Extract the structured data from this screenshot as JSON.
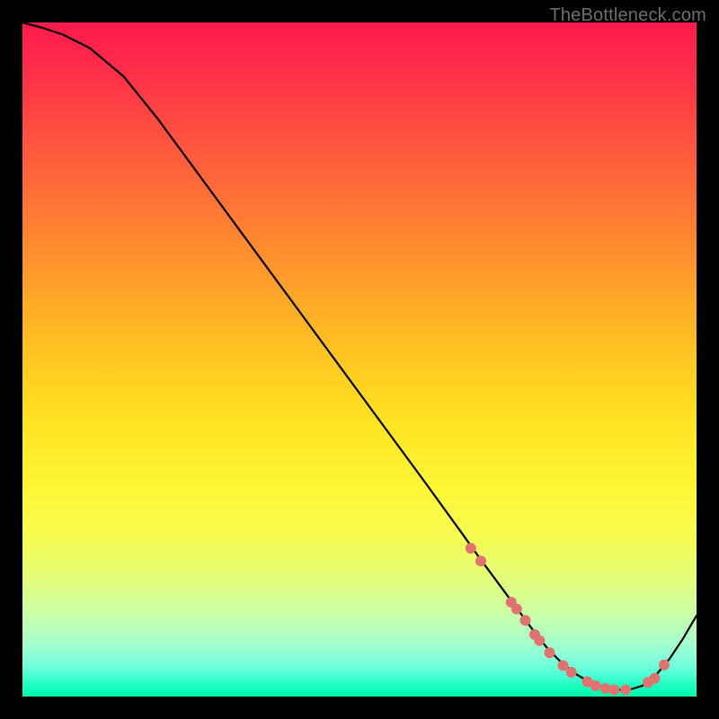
{
  "watermark": "TheBottleneck.com",
  "chart_data": {
    "type": "line",
    "title": "",
    "xlabel": "",
    "ylabel": "",
    "xlim": [
      0,
      100
    ],
    "ylim": [
      0,
      100
    ],
    "series": [
      {
        "name": "curve",
        "x": [
          0,
          3,
          6,
          10,
          15,
          20,
          25,
          30,
          35,
          40,
          45,
          50,
          55,
          60,
          65,
          68,
          70,
          72,
          74,
          76,
          78,
          80,
          82,
          84,
          86,
          88,
          90,
          92,
          94,
          96,
          98,
          100
        ],
        "y": [
          100,
          99.2,
          98.2,
          96.2,
          92.0,
          85.8,
          79.0,
          72.2,
          65.4,
          58.6,
          51.8,
          45.0,
          38.2,
          31.4,
          24.5,
          20.3,
          17.6,
          14.9,
          12.2,
          9.5,
          7.0,
          5.0,
          3.4,
          2.2,
          1.4,
          1.0,
          1.0,
          1.6,
          3.2,
          5.6,
          8.6,
          12.0
        ]
      }
    ],
    "markers": {
      "name": "dots",
      "x": [
        66.5,
        68.0,
        72.5,
        73.3,
        74.6,
        76.0,
        76.7,
        78.2,
        80.2,
        81.4,
        83.8,
        85.0,
        86.5,
        87.8,
        89.5,
        92.8,
        93.8,
        95.2
      ],
      "y": [
        22.0,
        20.1,
        14.0,
        13.0,
        11.3,
        9.2,
        8.3,
        6.5,
        4.6,
        3.6,
        2.2,
        1.6,
        1.2,
        1.0,
        1.0,
        2.1,
        2.7,
        4.7
      ]
    },
    "gradient_stops": [
      {
        "pos": 0,
        "color": "#ff1a4d"
      },
      {
        "pos": 50,
        "color": "#ffe024"
      },
      {
        "pos": 100,
        "color": "#00ffa7"
      }
    ]
  }
}
